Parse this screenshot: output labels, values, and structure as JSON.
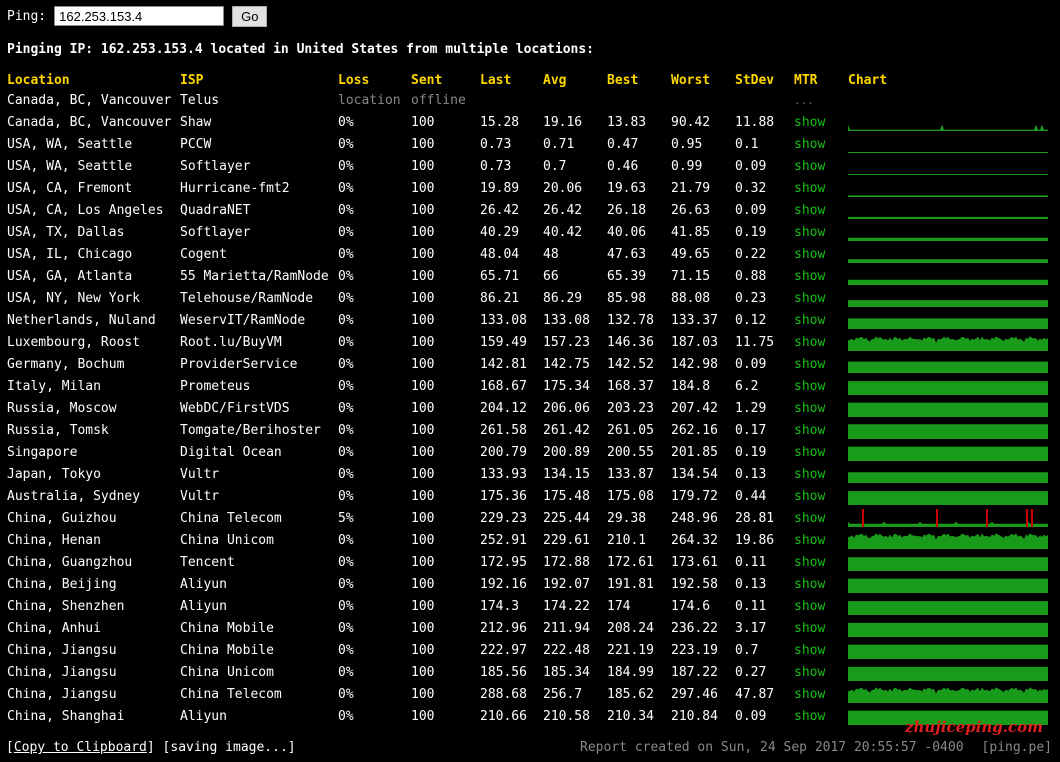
{
  "ping_form": {
    "label": "Ping:",
    "value": "162.253.153.4",
    "go_label": "Go"
  },
  "summary": {
    "prefix": "Pinging IP: 162.253.153.4 located in ",
    "country": "United States",
    "suffix": " from multiple locations:"
  },
  "columns": [
    "Location",
    "ISP",
    "Loss",
    "Sent",
    "Last",
    "Avg",
    "Best",
    "Worst",
    "StDev",
    "MTR",
    "Chart"
  ],
  "offline_row": {
    "location": "Canada, BC, Vancouver",
    "isp": "Telus",
    "loss": "location",
    "sent": "offline",
    "mtr": "..."
  },
  "rows": [
    {
      "location": "Canada, BC, Vancouver",
      "isp": "Shaw",
      "loss": "0%",
      "sent": "100",
      "last": "15.28",
      "avg": "19.16",
      "best": "13.83",
      "worst": "90.42",
      "stdev": "11.88",
      "mtr": "show",
      "chart_level": 0.08,
      "noise": "spiky"
    },
    {
      "location": "USA, WA, Seattle",
      "isp": "PCCW",
      "loss": "0%",
      "sent": "100",
      "last": "0.73",
      "avg": "0.71",
      "best": "0.47",
      "worst": "0.95",
      "stdev": "0.1",
      "mtr": "show",
      "chart_level": 0.02,
      "noise": "flat"
    },
    {
      "location": "USA, WA, Seattle",
      "isp": "Softlayer",
      "loss": "0%",
      "sent": "100",
      "last": "0.73",
      "avg": "0.7",
      "best": "0.46",
      "worst": "0.99",
      "stdev": "0.09",
      "mtr": "show",
      "chart_level": 0.02,
      "noise": "flat"
    },
    {
      "location": "USA, CA, Fremont",
      "isp": "Hurricane-fmt2",
      "loss": "0%",
      "sent": "100",
      "last": "19.89",
      "avg": "20.06",
      "best": "19.63",
      "worst": "21.79",
      "stdev": "0.32",
      "mtr": "show",
      "chart_level": 0.1,
      "noise": "flat"
    },
    {
      "location": "USA, CA, Los Angeles",
      "isp": "QuadraNET",
      "loss": "0%",
      "sent": "100",
      "last": "26.42",
      "avg": "26.42",
      "best": "26.18",
      "worst": "26.63",
      "stdev": "0.09",
      "mtr": "show",
      "chart_level": 0.13,
      "noise": "flat"
    },
    {
      "location": "USA, TX, Dallas",
      "isp": "Softlayer",
      "loss": "0%",
      "sent": "100",
      "last": "40.29",
      "avg": "40.42",
      "best": "40.06",
      "worst": "41.85",
      "stdev": "0.19",
      "mtr": "show",
      "chart_level": 0.2,
      "noise": "flat"
    },
    {
      "location": "USA, IL, Chicago",
      "isp": "Cogent",
      "loss": "0%",
      "sent": "100",
      "last": "48.04",
      "avg": "48",
      "best": "47.63",
      "worst": "49.65",
      "stdev": "0.22",
      "mtr": "show",
      "chart_level": 0.24,
      "noise": "flat"
    },
    {
      "location": "USA, GA, Atlanta",
      "isp": "55 Marietta/RamNode",
      "loss": "0%",
      "sent": "100",
      "last": "65.71",
      "avg": "66",
      "best": "65.39",
      "worst": "71.15",
      "stdev": "0.88",
      "mtr": "show",
      "chart_level": 0.33,
      "noise": "flat"
    },
    {
      "location": "USA, NY, New York",
      "isp": "Telehouse/RamNode",
      "loss": "0%",
      "sent": "100",
      "last": "86.21",
      "avg": "86.29",
      "best": "85.98",
      "worst": "88.08",
      "stdev": "0.23",
      "mtr": "show",
      "chart_level": 0.43,
      "noise": "flat"
    },
    {
      "location": "Netherlands, Nuland",
      "isp": "WeservIT/RamNode",
      "loss": "0%",
      "sent": "100",
      "last": "133.08",
      "avg": "133.08",
      "best": "132.78",
      "worst": "133.37",
      "stdev": "0.12",
      "mtr": "show",
      "chart_level": 0.66,
      "noise": "flat"
    },
    {
      "location": "Luxembourg, Roost",
      "isp": "Root.lu/BuyVM",
      "loss": "0%",
      "sent": "100",
      "last": "159.49",
      "avg": "157.23",
      "best": "146.36",
      "worst": "187.03",
      "stdev": "11.75",
      "mtr": "show",
      "chart_level": 0.78,
      "noise": "wavy"
    },
    {
      "location": "Germany, Bochum",
      "isp": "ProviderService",
      "loss": "0%",
      "sent": "100",
      "last": "142.81",
      "avg": "142.75",
      "best": "142.52",
      "worst": "142.98",
      "stdev": "0.09",
      "mtr": "show",
      "chart_level": 0.71,
      "noise": "flat"
    },
    {
      "location": "Italy, Milan",
      "isp": "Prometeus",
      "loss": "0%",
      "sent": "100",
      "last": "168.67",
      "avg": "175.34",
      "best": "168.37",
      "worst": "184.8",
      "stdev": "6.2",
      "mtr": "show",
      "chart_level": 0.87,
      "noise": "flat"
    },
    {
      "location": "Russia, Moscow",
      "isp": "WebDC/FirstVDS",
      "loss": "0%",
      "sent": "100",
      "last": "204.12",
      "avg": "206.06",
      "best": "203.23",
      "worst": "207.42",
      "stdev": "1.29",
      "mtr": "show",
      "chart_level": 0.9,
      "noise": "flat"
    },
    {
      "location": "Russia, Tomsk",
      "isp": "Tomgate/Berihoster",
      "loss": "0%",
      "sent": "100",
      "last": "261.58",
      "avg": "261.42",
      "best": "261.05",
      "worst": "262.16",
      "stdev": "0.17",
      "mtr": "show",
      "chart_level": 0.92,
      "noise": "flat"
    },
    {
      "location": "Singapore",
      "isp": "Digital Ocean",
      "loss": "0%",
      "sent": "100",
      "last": "200.79",
      "avg": "200.89",
      "best": "200.55",
      "worst": "201.85",
      "stdev": "0.19",
      "mtr": "show",
      "chart_level": 0.9,
      "noise": "flat"
    },
    {
      "location": "Japan, Tokyo",
      "isp": "Vultr",
      "loss": "0%",
      "sent": "100",
      "last": "133.93",
      "avg": "134.15",
      "best": "133.87",
      "worst": "134.54",
      "stdev": "0.13",
      "mtr": "show",
      "chart_level": 0.67,
      "noise": "flat"
    },
    {
      "location": "Australia, Sydney",
      "isp": "Vultr",
      "loss": "0%",
      "sent": "100",
      "last": "175.36",
      "avg": "175.48",
      "best": "175.08",
      "worst": "179.72",
      "stdev": "0.44",
      "mtr": "show",
      "chart_level": 0.87,
      "noise": "flat"
    },
    {
      "location": "China, Guizhou",
      "isp": "China Telecom",
      "loss": "5%",
      "sent": "100",
      "last": "229.23",
      "avg": "225.44",
      "best": "29.38",
      "worst": "248.96",
      "stdev": "28.81",
      "mtr": "show",
      "chart_level": 0.2,
      "noise": "loss"
    },
    {
      "location": "China, Henan",
      "isp": "China Unicom",
      "loss": "0%",
      "sent": "100",
      "last": "252.91",
      "avg": "229.61",
      "best": "210.1",
      "worst": "264.32",
      "stdev": "19.86",
      "mtr": "show",
      "chart_level": 0.85,
      "noise": "wavy"
    },
    {
      "location": "China, Guangzhou",
      "isp": "Tencent",
      "loss": "0%",
      "sent": "100",
      "last": "172.95",
      "avg": "172.88",
      "best": "172.61",
      "worst": "173.61",
      "stdev": "0.11",
      "mtr": "show",
      "chart_level": 0.86,
      "noise": "flat"
    },
    {
      "location": "China, Beijing",
      "isp": "Aliyun",
      "loss": "0%",
      "sent": "100",
      "last": "192.16",
      "avg": "192.07",
      "best": "191.81",
      "worst": "192.58",
      "stdev": "0.13",
      "mtr": "show",
      "chart_level": 0.9,
      "noise": "flat"
    },
    {
      "location": "China, Shenzhen",
      "isp": "Aliyun",
      "loss": "0%",
      "sent": "100",
      "last": "174.3",
      "avg": "174.22",
      "best": "174",
      "worst": "174.6",
      "stdev": "0.11",
      "mtr": "show",
      "chart_level": 0.87,
      "noise": "flat"
    },
    {
      "location": "China, Anhui",
      "isp": "China Mobile",
      "loss": "0%",
      "sent": "100",
      "last": "212.96",
      "avg": "211.94",
      "best": "208.24",
      "worst": "236.22",
      "stdev": "3.17",
      "mtr": "show",
      "chart_level": 0.88,
      "noise": "flat"
    },
    {
      "location": "China, Jiangsu",
      "isp": "China Mobile",
      "loss": "0%",
      "sent": "100",
      "last": "222.97",
      "avg": "222.48",
      "best": "221.19",
      "worst": "223.19",
      "stdev": "0.7",
      "mtr": "show",
      "chart_level": 0.9,
      "noise": "flat"
    },
    {
      "location": "China, Jiangsu",
      "isp": "China Unicom",
      "loss": "0%",
      "sent": "100",
      "last": "185.56",
      "avg": "185.34",
      "best": "184.99",
      "worst": "187.22",
      "stdev": "0.27",
      "mtr": "show",
      "chart_level": 0.88,
      "noise": "flat"
    },
    {
      "location": "China, Jiangsu",
      "isp": "China Telecom",
      "loss": "0%",
      "sent": "100",
      "last": "288.68",
      "avg": "256.7",
      "best": "185.62",
      "worst": "297.46",
      "stdev": "47.87",
      "mtr": "show",
      "chart_level": 0.85,
      "noise": "wavy"
    },
    {
      "location": "China, Shanghai",
      "isp": "Aliyun",
      "loss": "0%",
      "sent": "100",
      "last": "210.66",
      "avg": "210.58",
      "best": "210.34",
      "worst": "210.84",
      "stdev": "0.09",
      "mtr": "show",
      "chart_level": 0.9,
      "noise": "flat"
    }
  ],
  "footer": {
    "copy_label": "Copy to Clipboard",
    "saving_label": "[saving image...]",
    "report_created": "Report created on Sun, 24 Sep 2017 20:55:57 -0400",
    "site": "[ping.pe]"
  },
  "watermark": "zhujiceping.com",
  "colors": {
    "header": "#ffd700",
    "mtr_link": "#16c016",
    "chart_fill": "#1a9a1a",
    "loss_mark": "#cc0000",
    "muted": "#888888"
  }
}
